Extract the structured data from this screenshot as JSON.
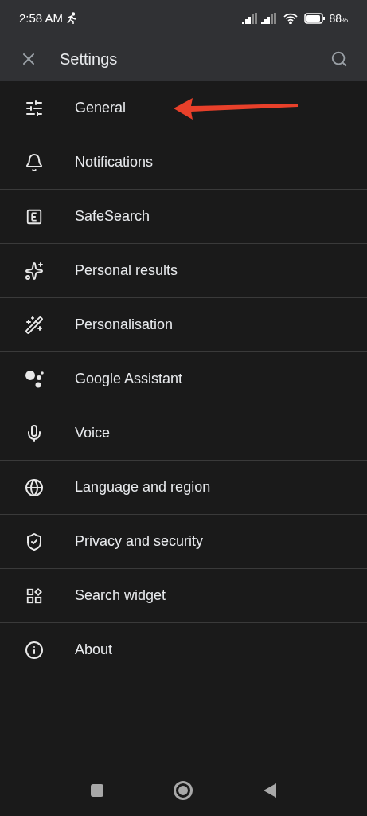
{
  "status_bar": {
    "time": "2:58 AM",
    "battery": "88",
    "battery_unit": "%"
  },
  "app_bar": {
    "title": "Settings"
  },
  "items": [
    {
      "label": "General",
      "annotated": true
    },
    {
      "label": "Notifications",
      "annotated": false
    },
    {
      "label": "SafeSearch",
      "annotated": false
    },
    {
      "label": "Personal results",
      "annotated": false
    },
    {
      "label": "Personalisation",
      "annotated": false
    },
    {
      "label": "Google Assistant",
      "annotated": false
    },
    {
      "label": "Voice",
      "annotated": false
    },
    {
      "label": "Language and region",
      "annotated": false
    },
    {
      "label": "Privacy and security",
      "annotated": false
    },
    {
      "label": "Search widget",
      "annotated": false
    },
    {
      "label": "About",
      "annotated": false
    }
  ]
}
